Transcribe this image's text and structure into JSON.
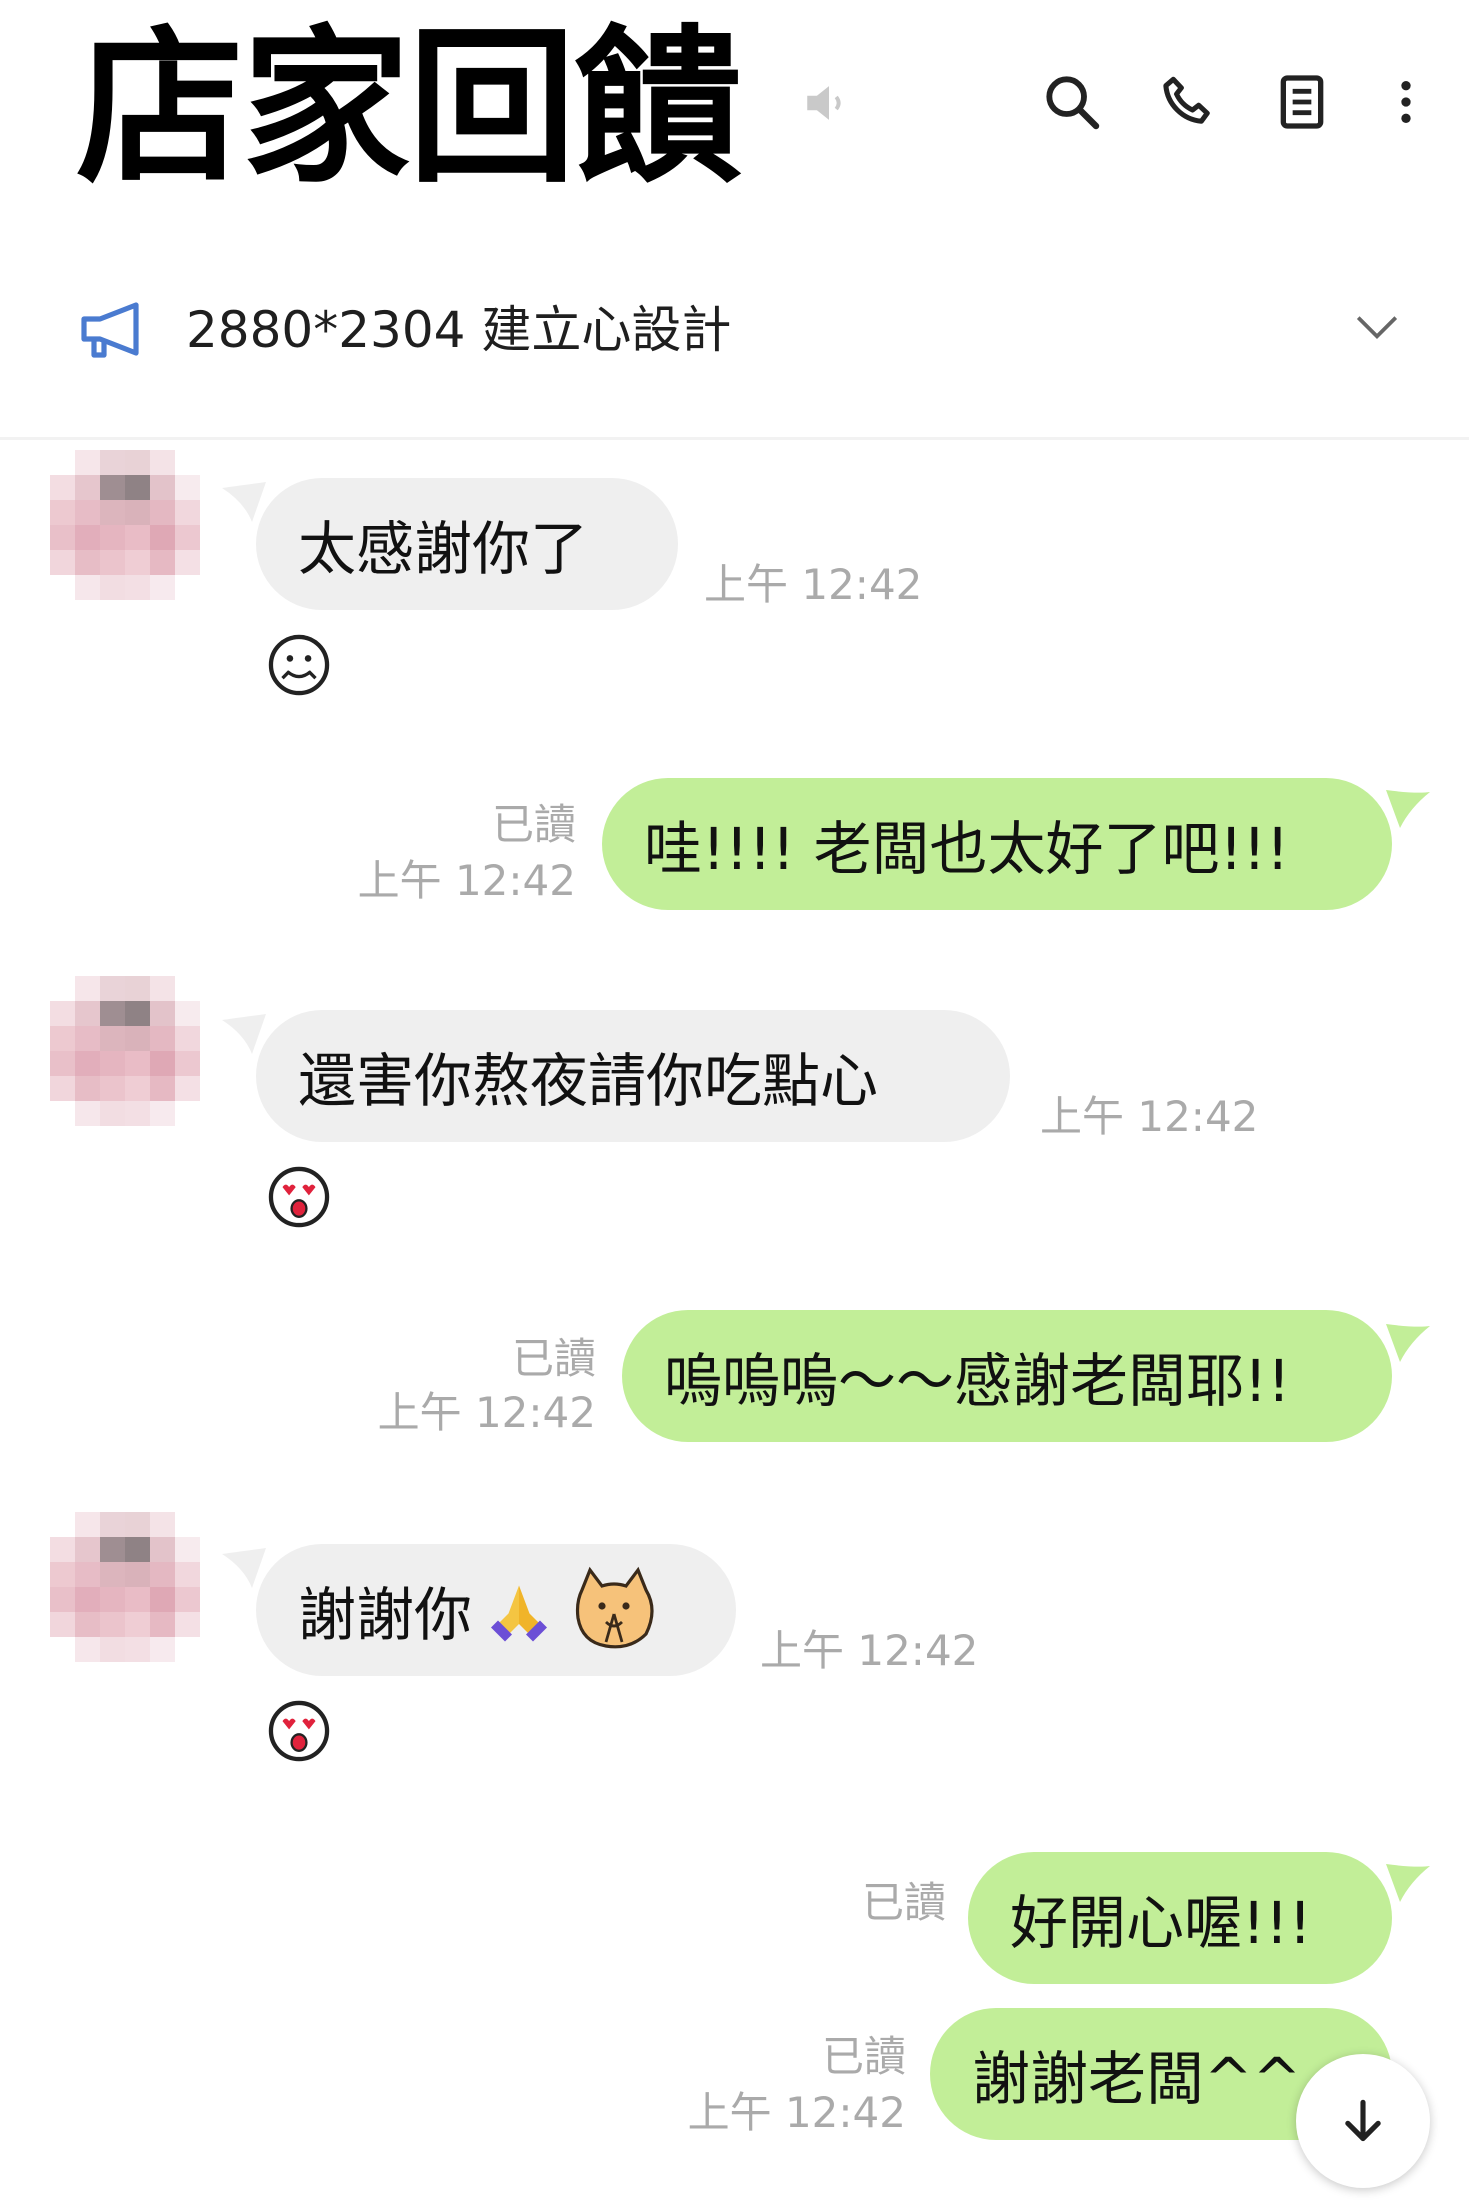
{
  "header": {
    "title": "店家回饋",
    "notice_text": "2880*2304 建立心設計"
  },
  "messages": [
    {
      "dir": "in",
      "text": "太感謝你了",
      "time": "上午 12:42"
    },
    {
      "dir": "out",
      "text": "哇!!!! 老闆也太好了吧!!!",
      "read": "已讀",
      "time": "上午 12:42"
    },
    {
      "dir": "in",
      "text": "還害你熬夜請你吃點心",
      "time": "上午 12:42"
    },
    {
      "dir": "out",
      "text": "嗚嗚嗚～～感謝老闆耶!!",
      "read": "已讀",
      "time": "上午 12:42"
    },
    {
      "dir": "in",
      "text": "謝謝你",
      "time": "上午 12:42"
    },
    {
      "dir": "out",
      "text": "好開心喔!!!",
      "read": "已讀"
    },
    {
      "dir": "out",
      "text": "謝謝老闆^^",
      "read": "已讀",
      "time": "上午 12:42"
    }
  ],
  "colors": {
    "incoming_bubble": "#efefef",
    "outgoing_bubble": "#c2ee98",
    "meta_text": "#aaaaaa",
    "notice_icon": "#4a7bd0"
  }
}
